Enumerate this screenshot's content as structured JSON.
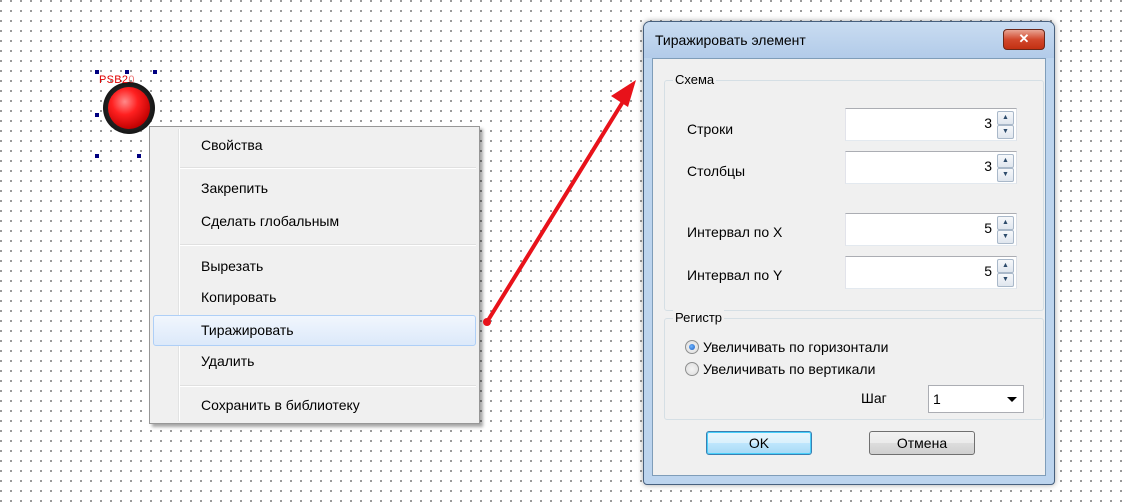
{
  "canvas": {
    "element_tag": "PSB2",
    "element_tag_suffix": "0"
  },
  "context_menu": {
    "items": [
      {
        "label": "Свойства"
      },
      {
        "label": "Закрепить"
      },
      {
        "label": "Сделать глобальным"
      },
      {
        "label": "Вырезать"
      },
      {
        "label": "Копировать"
      },
      {
        "label": "Тиражировать",
        "highlighted": true
      },
      {
        "label": "Удалить"
      },
      {
        "label": "Сохранить в библиотеку"
      }
    ]
  },
  "dialog": {
    "title": "Тиражировать элемент",
    "close_icon": "close-icon",
    "scheme": {
      "legend": "Схема",
      "rows_label": "Строки",
      "rows_value": "3",
      "cols_label": "Столбцы",
      "cols_value": "3",
      "interval_x_label": "Интервал по X",
      "interval_x_value": "5",
      "interval_y_label": "Интервал по Y",
      "interval_y_value": "5"
    },
    "register": {
      "legend": "Регистр",
      "option_horizontal": "Увеличивать по горизонтали",
      "option_vertical": "Увеличивать по вертикали",
      "selected": "horizontal",
      "step_label": "Шаг",
      "step_value": "1"
    },
    "ok_label": "OK",
    "cancel_label": "Отмена"
  },
  "colors": {
    "arrow": "#e8121a",
    "highlight_border": "#aecff7",
    "tag_text": "#e00000"
  }
}
